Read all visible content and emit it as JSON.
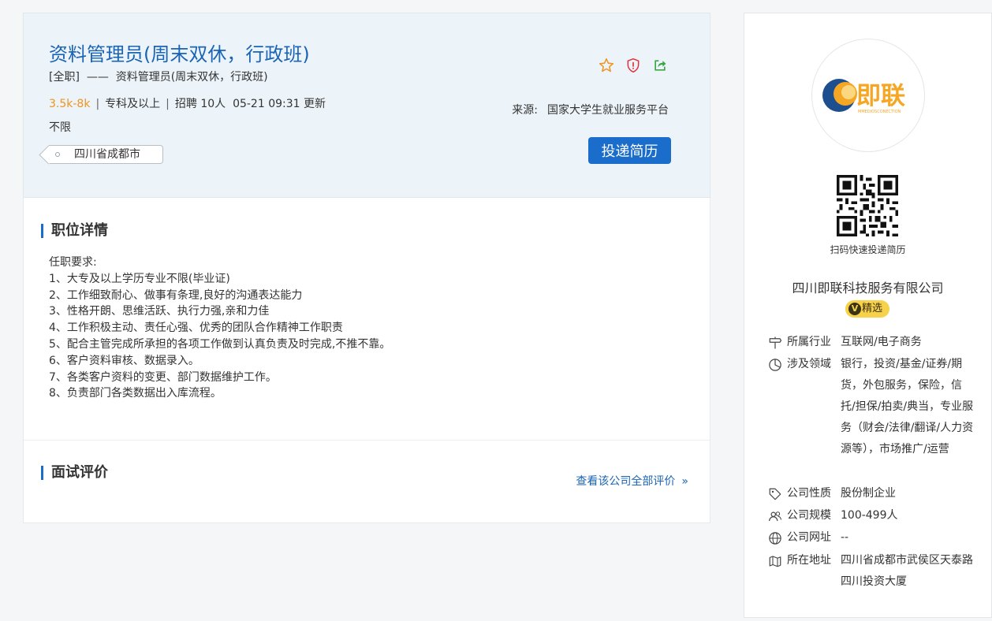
{
  "job": {
    "title": "资料管理员(周末双休，行政班)",
    "subtitle": "[全职]  ——  资料管理员(周末双休，行政班)",
    "salary": "3.5k-8k",
    "education": "专科及以上",
    "recruit": "招聘 10人",
    "updated": "05-21 09:31 更新",
    "experience": "不限",
    "location": "四川省成都市",
    "source_label": "来源:",
    "source_value": "国家大学生就业服务平台",
    "apply_label": "投递简历",
    "icons": [
      "star-icon",
      "report-shield-icon",
      "share-icon"
    ]
  },
  "detail": {
    "section_title": "职位详情",
    "requirements": [
      "任职要求:",
      "1、大专及以上学历专业不限(毕业证)",
      "2、工作细致耐心、做事有条理,良好的沟通表达能力",
      "3、性格开朗、思维活跃、执行力强,亲和力佳",
      "4、工作积极主动、责任心强、优秀的团队合作精神工作职责",
      "5、配合主管完成所承担的各项工作做到认真负责及时完成,不推不靠。",
      "6、客户资料审核、数据录入。",
      "7、各类客户资料的变更、部门数据维护工作。",
      "8、负责部门各类数据出入库流程。"
    ],
    "review_title": "面试评价",
    "review_link": "查看该公司全部评价",
    "review_chevron": "»"
  },
  "company": {
    "logo_text": "即联",
    "logo_subtext": "MMEDIOSCONECTION",
    "qr_caption": "扫码快速投递简历",
    "name": "四川即联科技服务有限公司",
    "badge": "精选",
    "badge_mark": "V",
    "info": [
      {
        "icon": "industry-signpost-icon",
        "key": "所属行业",
        "value": "互联网/电子商务"
      },
      {
        "icon": "domain-pie-icon",
        "key": "涉及领域",
        "value": "银行，投资/基金/证券/期货，外包服务，保险，信托/担保/拍卖/典当，专业服务（财会/法律/翻译/人力资源等），市场推广/运营"
      },
      {
        "icon": "tag-icon",
        "key": "公司性质",
        "value": "股份制企业"
      },
      {
        "icon": "people-icon",
        "key": "公司规模",
        "value": "100-499人"
      },
      {
        "icon": "globe-icon",
        "key": "公司网址",
        "value": "--"
      },
      {
        "icon": "map-icon",
        "key": "所在地址",
        "value": "四川省成都市武侯区天泰路四川投资大厦"
      }
    ]
  },
  "colors": {
    "title_blue": "#1a64b5",
    "button_blue": "#1a6dca",
    "salary_orange": "#f0941d",
    "header_bg": "#edf4f9",
    "badge_yellow": "#f6d14a"
  }
}
